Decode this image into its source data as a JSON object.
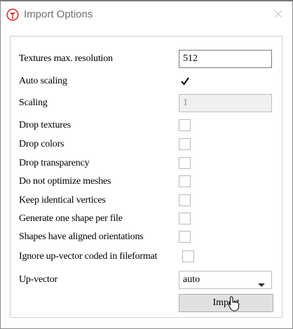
{
  "window": {
    "title": "Import Options",
    "app_icon": "pin-logo-icon",
    "close_icon": "close-icon"
  },
  "form": {
    "textures_max_resolution": {
      "label": "Textures max. resolution",
      "value": "512"
    },
    "auto_scaling": {
      "label": "Auto scaling",
      "checked": true
    },
    "scaling": {
      "label": "Scaling",
      "value": "1",
      "disabled": true
    },
    "checkboxes": [
      {
        "label": "Drop textures",
        "checked": false
      },
      {
        "label": "Drop colors",
        "checked": false
      },
      {
        "label": "Drop transparency",
        "checked": false
      },
      {
        "label": "Do not optimize meshes",
        "checked": false
      },
      {
        "label": "Keep identical vertices",
        "checked": false
      },
      {
        "label": "Generate one shape per file",
        "checked": false
      },
      {
        "label": "Shapes have aligned orientations",
        "checked": false
      },
      {
        "label": "Ignore up-vector coded in fileformat",
        "checked": false
      }
    ],
    "up_vector": {
      "label": "Up-vector",
      "selected": "auto"
    },
    "import_button": "Import"
  },
  "colors": {
    "accent_logo": "#e0302a"
  }
}
